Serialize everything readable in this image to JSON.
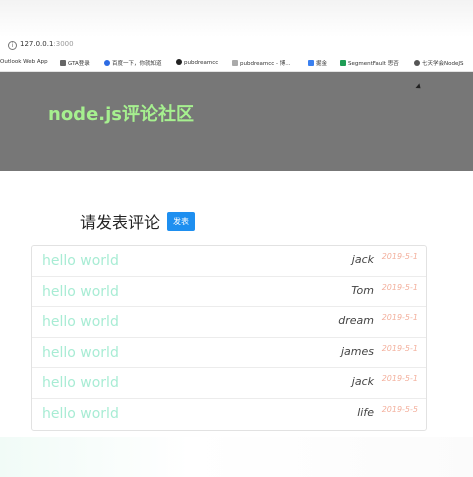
{
  "browser": {
    "url_host": "127.0.0.1",
    "url_port": ":3000",
    "bookmarks": [
      {
        "label": "Outlook Web App",
        "icon": "outlook-icon"
      },
      {
        "label": "GTA登录",
        "icon": "gta-icon"
      },
      {
        "label": "百度一下，你就知道",
        "icon": "baidu-icon"
      },
      {
        "label": "pubdreamcc",
        "icon": "github-icon"
      },
      {
        "label": "pubdreamcc - 博...",
        "icon": "blog-icon"
      },
      {
        "label": "掘金",
        "icon": "juejin-icon"
      },
      {
        "label": "SegmentFault 思否",
        "icon": "segmentfault-icon"
      },
      {
        "label": "七天学会NodeJS",
        "icon": "globe-icon"
      }
    ]
  },
  "header": {
    "title": "node.js评论社区"
  },
  "comment_section": {
    "heading": "请发表评论",
    "publish_label": "发表",
    "comments": [
      {
        "message": "hello world",
        "user": "jack",
        "date": "2019-5-1"
      },
      {
        "message": "hello world",
        "user": "Tom",
        "date": "2019-5-1"
      },
      {
        "message": "hello world",
        "user": "dream",
        "date": "2019-5-1"
      },
      {
        "message": "hello world",
        "user": "james",
        "date": "2019-5-1"
      },
      {
        "message": "hello world",
        "user": "jack",
        "date": "2019-5-1"
      },
      {
        "message": "hello world",
        "user": "life",
        "date": "2019-5-5"
      }
    ]
  },
  "colors": {
    "hero_bg": "#777777",
    "title_green": "#a6f08f",
    "message_mint": "#a8ecd4",
    "date_salmon": "#f3b09d",
    "button_blue": "#1e8ff0"
  }
}
